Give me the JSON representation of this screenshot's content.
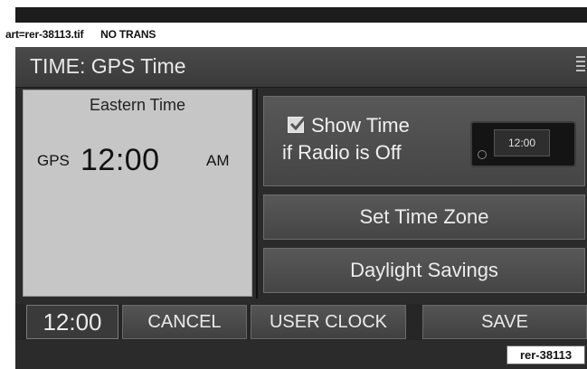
{
  "art_label": "art=rer-38113.tif      NO TRANS",
  "header": {
    "title": "TIME: GPS Time",
    "menu_icon": "menu-icon"
  },
  "time_panel": {
    "zone": "Eastern Time",
    "source": "GPS",
    "time": "12:00",
    "ampm": "AM"
  },
  "show_time": {
    "checked": true,
    "line1": "Show Time",
    "line2": "if Radio is Off",
    "radio_display": "12:00"
  },
  "buttons": {
    "set_time_zone": "Set Time Zone",
    "daylight_savings": "Daylight Savings"
  },
  "bottom_bar": {
    "clock": "12:00",
    "cancel": "CANCEL",
    "user_clock": "USER CLOCK",
    "save": "SAVE"
  },
  "reference": "rer-38113"
}
